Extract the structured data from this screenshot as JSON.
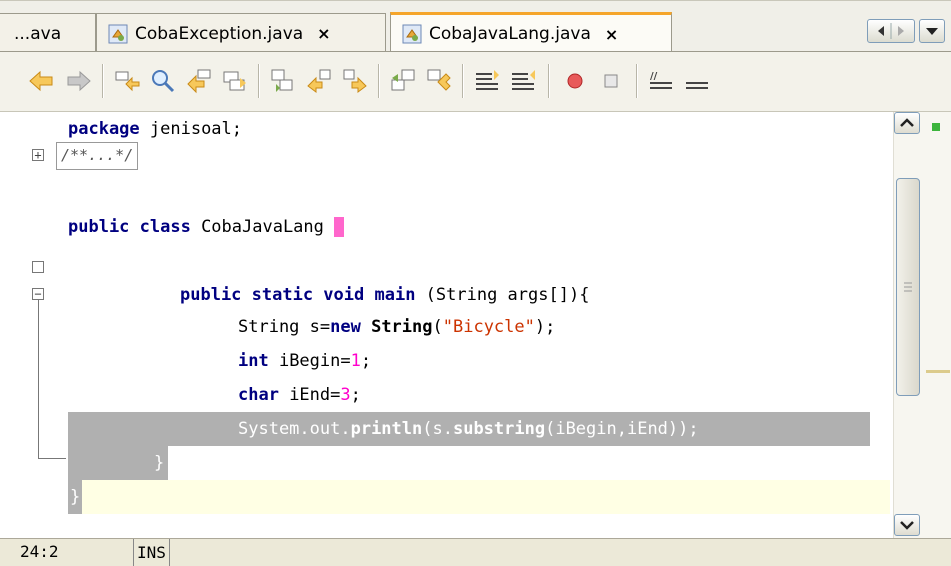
{
  "tabs": [
    {
      "label": "...ava",
      "closable": false,
      "active": false
    },
    {
      "label": "CobaException.java",
      "close": "×",
      "active": false
    },
    {
      "label": "CobaJavaLang.java",
      "close": "×",
      "active": true
    }
  ],
  "toolbar": {
    "buttons": [
      "back-icon",
      "forward-icon",
      "find-selection-icon",
      "find-icon",
      "find-previous-icon",
      "find-next-icon",
      "toggle-highlight-icon",
      "toggle-bookmark-icon",
      "previous-bookmark-icon",
      "next-bookmark-icon",
      "shift-left-icon",
      "shift-right-icon",
      "start-macro-icon",
      "stop-macro-icon",
      "comment-icon",
      "uncomment-icon"
    ]
  },
  "code": {
    "line1_kw": "package",
    "line1_rest": " jenisoal;",
    "collapsed_comment": "/**...*/",
    "class_kw": "public class",
    "class_name": " CobaJavaLang ",
    "open_brace": "{",
    "main_kw": "public static void",
    "main_name": "main",
    "main_rest": " (String args[]){",
    "s_decl_a": "String s=",
    "s_decl_new": "new",
    "s_decl_string": " String",
    "s_decl_b": "(",
    "s_decl_str": "\"Bicycle\"",
    "s_decl_c": ");",
    "ib_kw": "int",
    "ib_rest": " iBegin=",
    "ib_num": "1",
    "ib_end": ";",
    "ie_kw": "char",
    "ie_rest": " iEnd=",
    "ie_num": "3",
    "ie_end": ";",
    "println_a": "System.out.",
    "println_b": "println",
    "println_c": "(s.",
    "println_d": "substring",
    "println_e": "(iBegin,iEnd));",
    "close_method": "}",
    "close_class": "}"
  },
  "status": {
    "position": "24:2",
    "mode": "INS"
  }
}
